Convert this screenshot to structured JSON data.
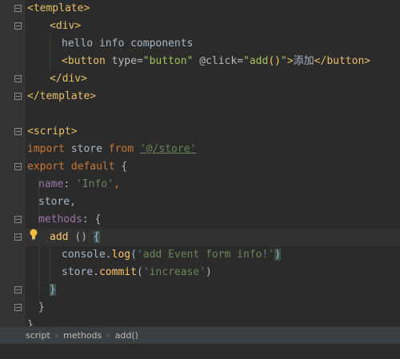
{
  "code": {
    "l1_tag": "template",
    "l2_tag": "div",
    "l3_text": "hello info components",
    "l4_button_tag": "button",
    "l4_attr_type": "type",
    "l4_type_val": "\"button\"",
    "l4_attr_click": "@click",
    "l4_click_val_open": "\"add",
    "l4_click_val_paren": "()",
    "l4_click_val_close": "\"",
    "l4_button_text": "添加",
    "l4_button_close": "button",
    "l5_tag": "div",
    "l6_tag": "template",
    "l8_tag": "script",
    "l9_import": "import",
    "l9_store": "store",
    "l9_from": "from",
    "l9_path": "'@/store'",
    "l10_export": "export",
    "l10_default": "default",
    "l10_brace": "{",
    "l11_name": "name",
    "l11_val": "'Info'",
    "l12_store": "store,",
    "l13_methods": "methods",
    "l13_brace": "{",
    "l14_add": "add",
    "l14_parens": "()",
    "l14_brace": "{",
    "l15_console": "console.",
    "l15_log": "log",
    "l15_paren_open": "(",
    "l15_str": "'add Event form info!'",
    "l15_paren_close": ")",
    "l16_store": "store.",
    "l16_commit": "commit",
    "l16_args": "(",
    "l16_str": "'increase'",
    "l16_close": ")",
    "l17_brace": "}",
    "l18_brace": "}",
    "l19_brace": "}"
  },
  "breadcrumb": {
    "items": [
      "script",
      "methods",
      "add()"
    ],
    "separator": "›"
  },
  "colors": {
    "background": "#2b2b2b",
    "tag": "#e8bf6a",
    "keyword": "#cc7832",
    "string": "#6a8759",
    "property": "#9876aa",
    "function": "#ffc66d",
    "text": "#a9b7c6"
  },
  "icons": [
    "fold-icon",
    "lightbulb-icon"
  ]
}
